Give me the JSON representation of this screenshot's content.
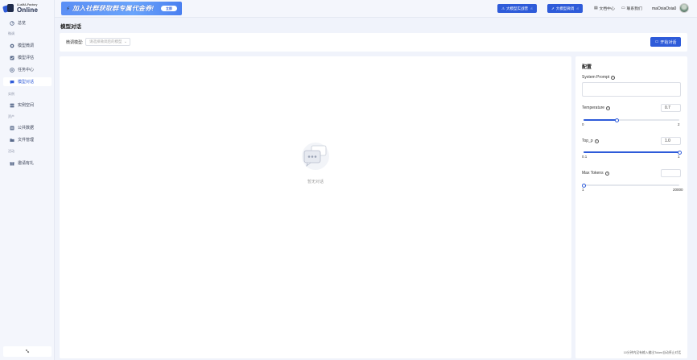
{
  "brand": {
    "small": "LLaMA-Factory",
    "big": "Online"
  },
  "sidebar": {
    "items": [
      {
        "label": "总览",
        "icon": "dashboard-icon"
      },
      {
        "label": "模型微调",
        "icon": "tune-icon"
      },
      {
        "label": "模型评估",
        "icon": "evaluate-icon"
      },
      {
        "label": "任务中心",
        "icon": "task-icon"
      },
      {
        "label": "模型对话",
        "icon": "chat-icon"
      },
      {
        "label": "实例空间",
        "icon": "instance-icon"
      },
      {
        "label": "公共数据",
        "icon": "data-icon"
      },
      {
        "label": "文件管理",
        "icon": "folder-icon"
      },
      {
        "label": "邀请有礼",
        "icon": "gift-icon"
      }
    ],
    "groups": [
      "微调",
      "实例",
      "资产",
      "活动"
    ],
    "active": "模型对话",
    "collapse_icon": "collapse-icon"
  },
  "header": {
    "banner_text": "加入社群获取群专属代金券!",
    "banner_button": "立即",
    "btn_practice": "大模型实战营",
    "btn_finetune": "大模型微调",
    "link_docs": "文档中心",
    "link_contact": "联系我们",
    "username": "maOxiaOxia0",
    "accent": "#2e5bd9"
  },
  "page": {
    "title": "模型对话",
    "filter_label": "微调模型:",
    "filter_placeholder": "请选择微调后的模型",
    "start_button": "开始对话",
    "empty_text": "暂无对话"
  },
  "config": {
    "title": "配置",
    "system_prompt_label": "System Prompt",
    "system_prompt_value": "",
    "temperature_label": "Temperature",
    "temperature_value": "0.7",
    "temperature_min": "0",
    "temperature_max": "2",
    "temperature_level": 0.35,
    "top_p_label": "Top_p",
    "top_p_value": "1.0",
    "top_p_min": "0.1",
    "top_p_max": "1",
    "top_p_level": 1.0,
    "max_tokens_label": "Max Tokens",
    "max_tokens_value": "",
    "max_tokens_min": "1",
    "max_tokens_max": "20000",
    "max_tokens_level": 0.0,
    "note": "10分钟内没有输入输出Token自动停止对话"
  }
}
